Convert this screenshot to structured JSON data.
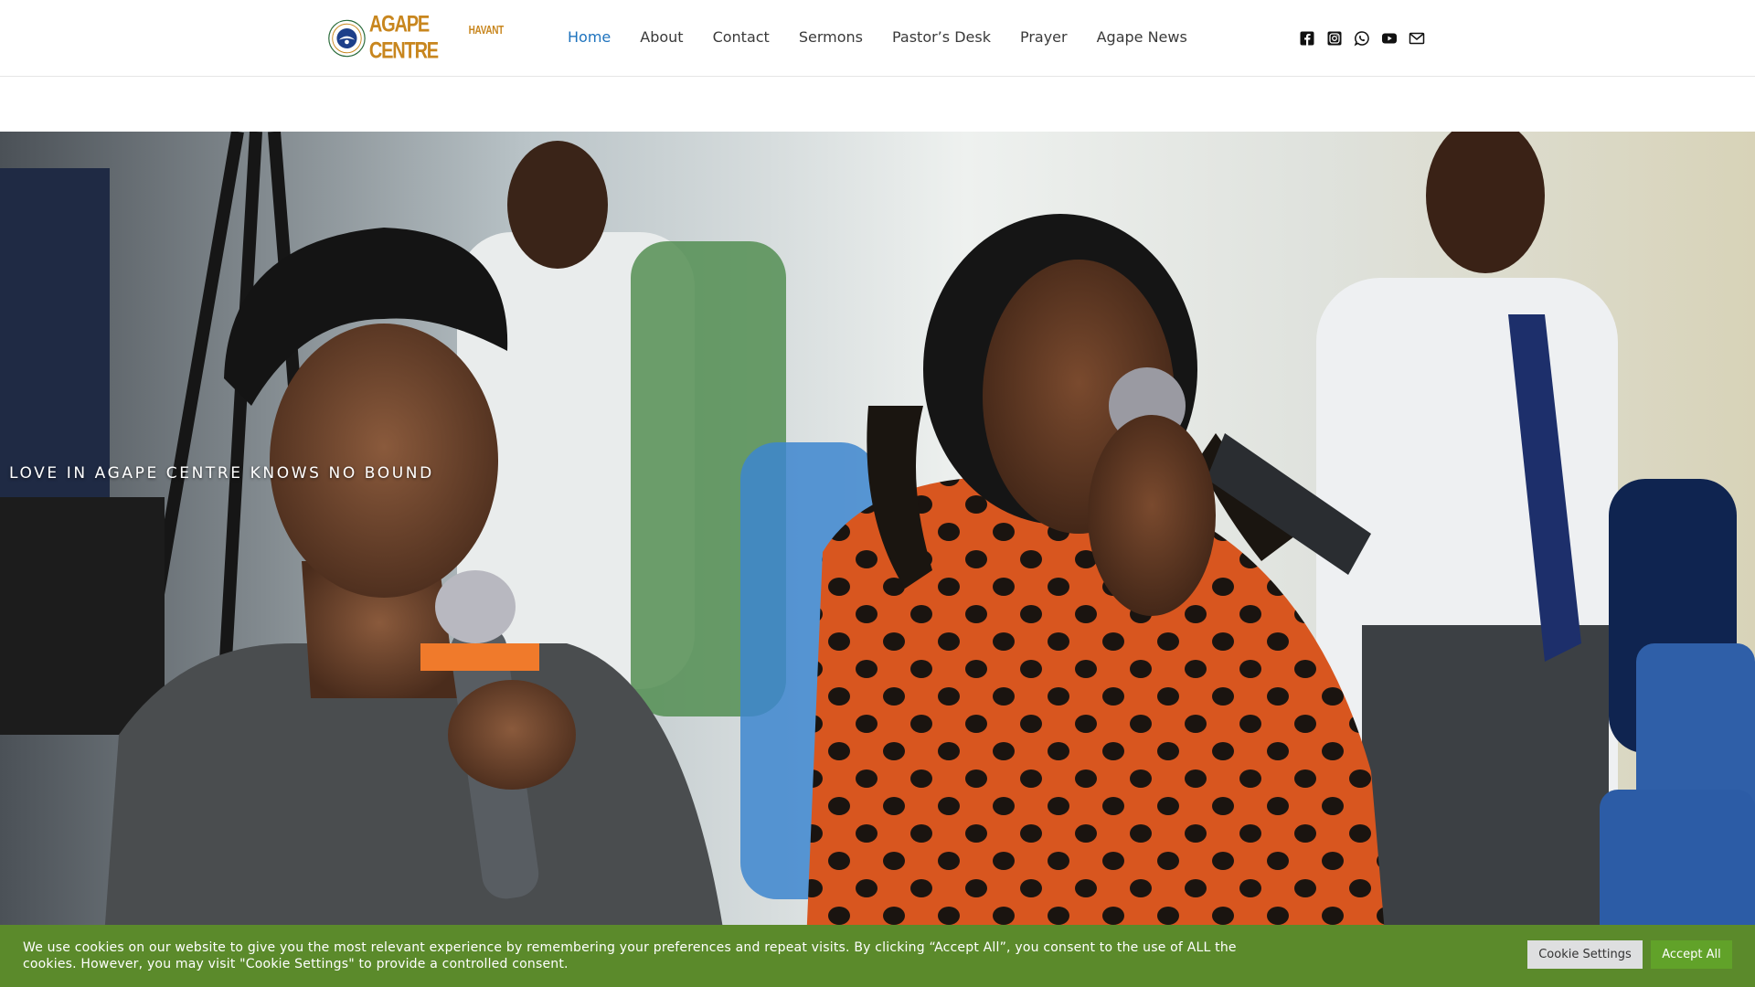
{
  "header": {
    "logo": {
      "seal_text": "THE REDEEMED CHRISTIAN CHURCH OF GOD",
      "name": "AGAPE CENTRE",
      "location": "HAVANT"
    },
    "nav": [
      {
        "label": "Home",
        "active": true
      },
      {
        "label": "About",
        "active": false
      },
      {
        "label": "Contact",
        "active": false
      },
      {
        "label": "Sermons",
        "active": false
      },
      {
        "label": "Pastor’s Desk",
        "active": false
      },
      {
        "label": "Prayer",
        "active": false
      },
      {
        "label": "Agape News",
        "active": false
      }
    ],
    "social_icons": [
      "facebook-icon",
      "instagram-icon",
      "whatsapp-icon",
      "youtube-icon",
      "email-icon"
    ]
  },
  "hero": {
    "tagline": "LOVE IN AGAPE CENTRE KNOWS NO BOUND"
  },
  "cookie_bar": {
    "message": "We use cookies on our website to give you the most relevant experience by remembering your preferences and repeat visits. By clicking “Accept All”, you consent to the use of ALL the cookies. However, you may visit \"Cookie Settings\" to provide a controlled consent.",
    "settings_label": "Cookie Settings",
    "accept_label": "Accept All"
  },
  "colors": {
    "nav_active": "#1e73be",
    "logo_gold": "#c8861e",
    "cookie_bar": "#5b8a2b",
    "accept_button": "#61a229"
  }
}
